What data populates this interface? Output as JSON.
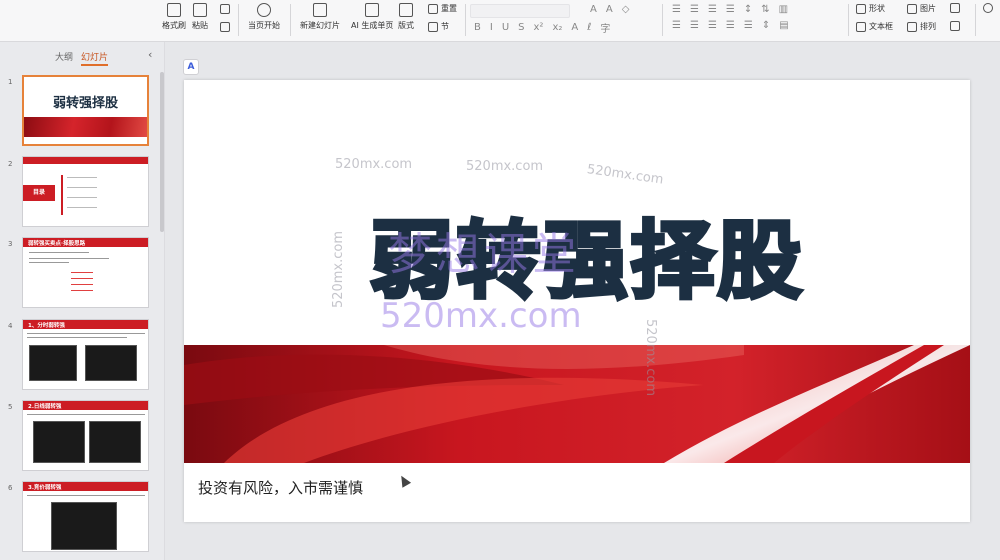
{
  "toolbar": {
    "format_painter": "格式刷",
    "paste": "粘贴",
    "start_from_current": "当页开始",
    "new_slide": "新建幻灯片",
    "ai_generate": "AI 生成单页",
    "layout": "版式",
    "reset": "重置",
    "section": "节",
    "shape": "形状",
    "picture": "图片",
    "textbox": "文本框",
    "arrange": "排列"
  },
  "panel": {
    "tab_outline": "大纲",
    "tab_slides": "幻灯片",
    "slide_numbers": [
      "1",
      "2",
      "3",
      "4",
      "5",
      "6"
    ],
    "thumb1_title": "弱转强择股",
    "thumb2_label": "目录",
    "thumb3_title": "弱转强买卖点·择股思路",
    "thumb4_title": "1、分时弱转强",
    "thumb5_title": "2.日线弱转强",
    "thumb6_title": "3.竞价弱转强"
  },
  "slide": {
    "title": "弱转强择股",
    "footnote": "投资有风险，入市需谨慎"
  },
  "watermarks": {
    "url": "520mx.com",
    "center_text": "梦想课堂",
    "center_url": "520mx.com"
  },
  "colors": {
    "brand_red": "#cc1d24",
    "title_navy": "#1c2f42",
    "tab_accent": "#e06e2a"
  }
}
